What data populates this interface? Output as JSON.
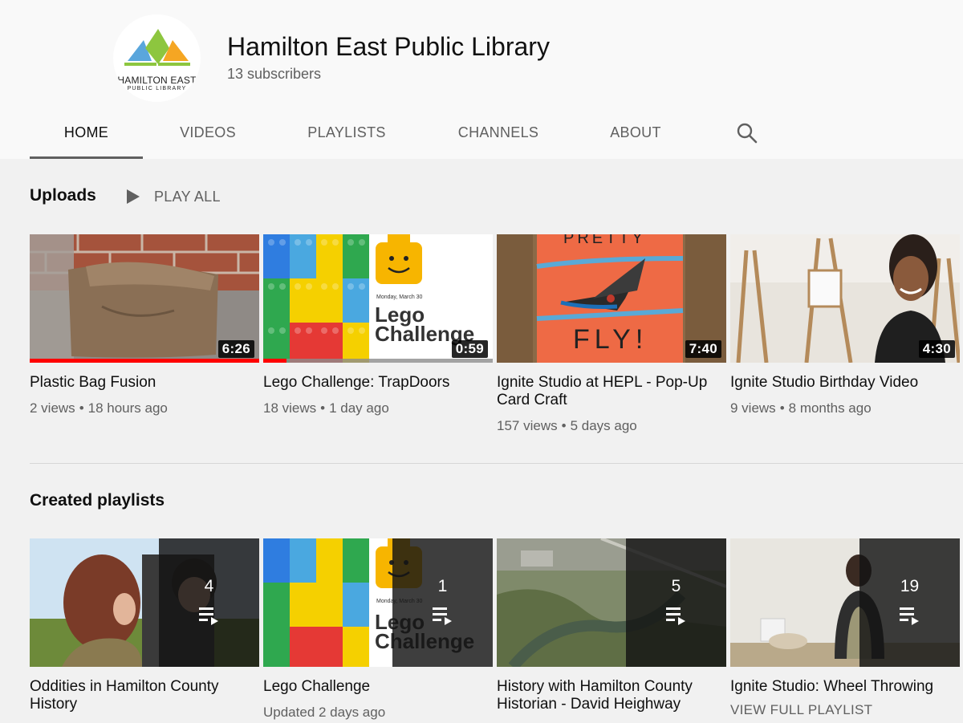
{
  "channel": {
    "title": "Hamilton East Public Library",
    "subscribers": "13 subscribers",
    "logo_line1": "HAMILTON EAST",
    "logo_line2": "PUBLIC LIBRARY"
  },
  "tabs": [
    {
      "label": "HOME",
      "active": true
    },
    {
      "label": "VIDEOS",
      "active": false
    },
    {
      "label": "PLAYLISTS",
      "active": false
    },
    {
      "label": "CHANNELS",
      "active": false
    },
    {
      "label": "ABOUT",
      "active": false
    }
  ],
  "uploads": {
    "title": "Uploads",
    "play_all": "PLAY ALL",
    "videos": [
      {
        "title": "Plastic Bag Fusion",
        "views": "2 views",
        "age": "18 hours ago",
        "duration": "6:26",
        "watched_fraction": 1.0
      },
      {
        "title": "Lego Challenge: TrapDoors",
        "views": "18 views",
        "age": "1 day ago",
        "duration": "0:59",
        "watched_fraction": 0.1,
        "thumb_date": "Monday, March 30",
        "thumb_line1": "Lego",
        "thumb_line2": "Challenge"
      },
      {
        "title": "Ignite Studio at HEPL - Pop-Up Card Craft",
        "views": "157 views",
        "age": "5 days ago",
        "duration": "7:40",
        "thumb_top": "PRETTY",
        "thumb_bottom": "FLY!"
      },
      {
        "title": "Ignite Studio Birthday Video",
        "views": "9 views",
        "age": "8 months ago",
        "duration": "4:30"
      }
    ]
  },
  "playlists": {
    "title": "Created playlists",
    "items": [
      {
        "title": "Oddities in Hamilton County History",
        "count": "4",
        "meta": ""
      },
      {
        "title": "Lego Challenge",
        "count": "1",
        "meta": "Updated 2 days ago",
        "thumb_date": "Monday, March 30",
        "thumb_line1": "Lego",
        "thumb_line2": "Challenge"
      },
      {
        "title": "History with Hamilton County Historian - David Heighway",
        "count": "5",
        "meta": ""
      },
      {
        "title": "Ignite Studio: Wheel Throwing",
        "count": "19",
        "meta": "",
        "action": "VIEW FULL PLAYLIST"
      }
    ]
  },
  "colors": {
    "progress_red": "#ff0000",
    "logo_blue": "#5aa6dc",
    "logo_green": "#8dc63f",
    "logo_orange": "#f5a623"
  },
  "icons": {
    "search": "search-icon",
    "play": "play-icon",
    "playlist": "playlist-play-icon"
  }
}
